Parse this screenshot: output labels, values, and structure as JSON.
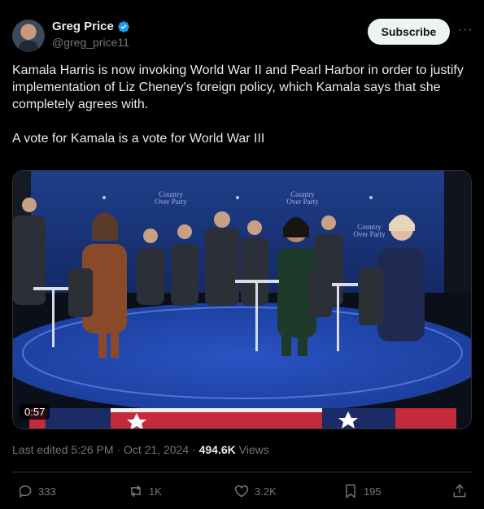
{
  "author": {
    "name": "Greg Price",
    "handle": "@greg_price11",
    "verified": true
  },
  "subscribe_label": "Subscribe",
  "more_label": "···",
  "tweet_text": "Kamala Harris is now invoking World War II and Pearl Harbor in order to justify implementation of Liz Cheney's foreign policy, which Kamala says that she completely agrees with.\n\nA vote for Kamala is a vote for World War III",
  "media": {
    "duration": "0:57",
    "backdrop_text": "Country\nOver Party"
  },
  "meta": {
    "edited": "Last edited 5:26 PM · Oct 21, 2024",
    "separator": " · ",
    "views_count": "494.6K",
    "views_label": " Views"
  },
  "actions": {
    "replies": "333",
    "reposts": "1K",
    "likes": "3.2K",
    "bookmarks": "195"
  },
  "colors": {
    "background": "#000000",
    "text": "#e7e9ea",
    "muted": "#71767b",
    "verified": "#1d9bf0"
  }
}
